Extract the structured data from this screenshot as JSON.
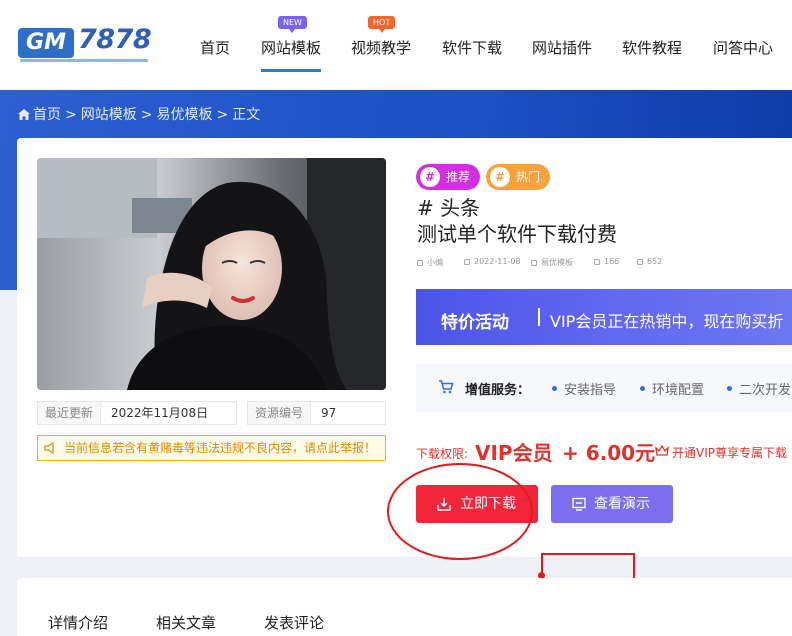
{
  "logo": {
    "gm": "GM",
    "number": "7878"
  },
  "nav": {
    "items": [
      "首页",
      "网站模板",
      "视频教学",
      "软件下载",
      "网站插件",
      "软件教程",
      "问答中心"
    ],
    "active_index": 1,
    "badges": {
      "new": "NEW",
      "hot": "HOT"
    }
  },
  "breadcrumb": [
    "首页",
    ">",
    "网站模板",
    ">",
    "易优模板",
    ">",
    "正文"
  ],
  "resource": {
    "updated_label": "最近更新",
    "updated_value": "2022年11月08日",
    "id_label": "资源编号",
    "id_value": "97",
    "warning": "当前信息若含有黄赌毒等违法违规不良内容，请点此举报！"
  },
  "tags": [
    "推荐",
    "热门"
  ],
  "tag_hash": "#",
  "headline": "# 头条",
  "title": "测试单个软件下载付费",
  "info": {
    "author": "小编",
    "date": "2022-11-08",
    "category": "易优模板",
    "likes": "166",
    "views": "652"
  },
  "promo": {
    "strong": "特价活动",
    "text": "VIP会员正在热销中，现在购买折"
  },
  "service": {
    "label": "增值服务：",
    "items": [
      "安装指导",
      "环境配置",
      "二次开发"
    ]
  },
  "price": {
    "label": "下载权限:",
    "vip": "VIP会员",
    "amount": "+ 6.00元",
    "note": "开通VIP尊享专属下载"
  },
  "buttons": {
    "download": "立即下载",
    "demo": "查看演示"
  },
  "tabs": [
    "详情介绍",
    "相关文章",
    "发表评论"
  ],
  "colors": {
    "accent": "#2a7bd8",
    "banner": "#1f53c9",
    "download": "#f2253a",
    "demo": "#7b6ff0",
    "price": "#e0312a",
    "annotation": "#e01b1b"
  }
}
